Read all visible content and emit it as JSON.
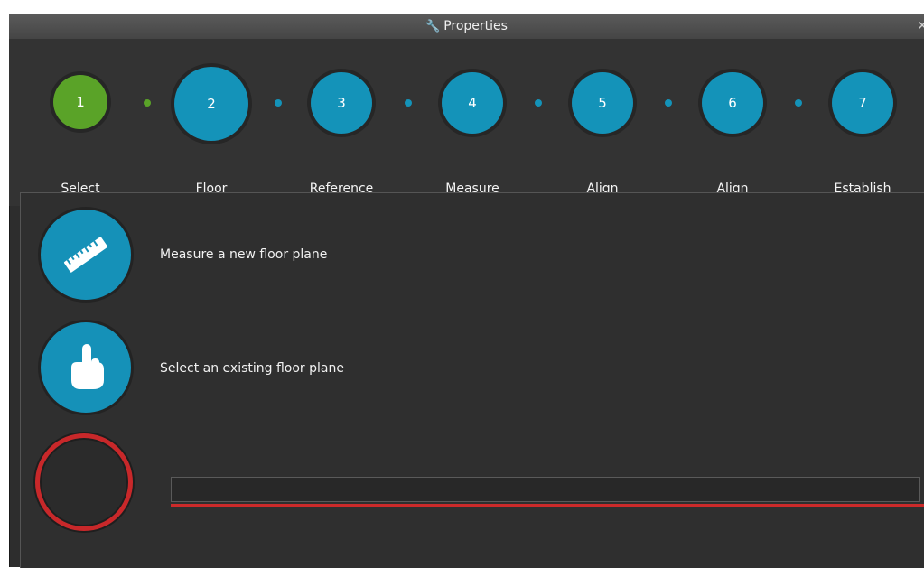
{
  "window": {
    "title": "Properties",
    "title_icon": "wrench-icon",
    "close_icon": "close-icon",
    "close_glyph": "✕"
  },
  "wizard": {
    "steps": [
      {
        "number": "1",
        "label": "Select",
        "state": "done"
      },
      {
        "number": "2",
        "label": "Floor",
        "state": "active"
      },
      {
        "number": "3",
        "label": "Reference",
        "state": "pending"
      },
      {
        "number": "4",
        "label": "Measure",
        "state": "pending"
      },
      {
        "number": "5",
        "label": "Align",
        "state": "pending"
      },
      {
        "number": "6",
        "label": "Align",
        "state": "pending"
      },
      {
        "number": "7",
        "label": "Establish",
        "state": "pending"
      }
    ]
  },
  "options": {
    "measure_label": "Measure a new floor plane",
    "measure_icon": "ruler-icon",
    "select_label": "Select an existing floor plane",
    "select_icon": "pointing-hand-icon"
  },
  "input": {
    "value": ""
  },
  "colors": {
    "done": "#5aa328",
    "pending": "#1493b9",
    "error": "#c8282a",
    "background": "#2d2d2d"
  }
}
